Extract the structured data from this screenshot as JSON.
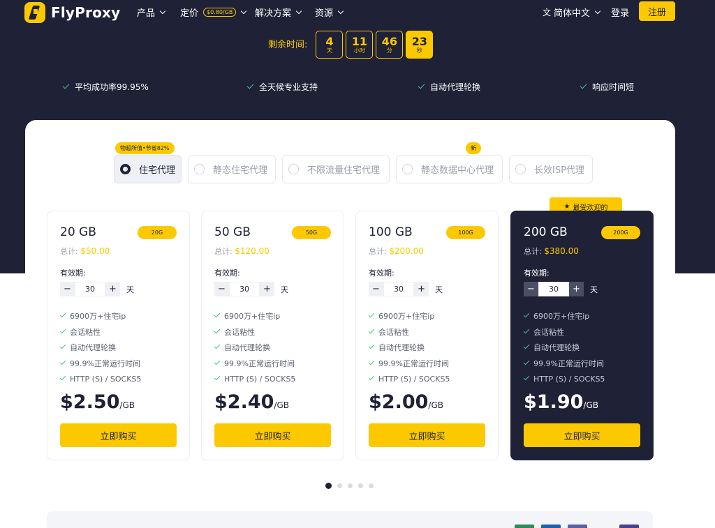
{
  "nav": {
    "brand": "FlyProxy",
    "items": [
      {
        "label": "产品"
      },
      {
        "label": "定价",
        "pill": "$0.80/GB"
      },
      {
        "label": "解决方案"
      },
      {
        "label": "资源"
      }
    ],
    "language": "简体中文",
    "login": "登录",
    "register": "注册"
  },
  "countdown": {
    "label": "剩余时间:",
    "units": [
      {
        "value": "4",
        "unit": "天"
      },
      {
        "value": "11",
        "unit": "小时"
      },
      {
        "value": "46",
        "unit": "分"
      },
      {
        "value": "23",
        "unit": "秒"
      }
    ]
  },
  "features": [
    "平均成功率99.95%",
    "全天候专业支持",
    "自动代理轮换",
    "响应时间短"
  ],
  "product_tabs": [
    {
      "label": "住宅代理",
      "selected": true,
      "tag": "物超所值•节省82%"
    },
    {
      "label": "静态住宅代理",
      "selected": false
    },
    {
      "label": "不限流量住宅代理",
      "selected": false
    },
    {
      "label": "静态数据中心代理",
      "selected": false,
      "tag": "新"
    },
    {
      "label": "长效ISP代理",
      "selected": false
    }
  ],
  "popular_label": "最受欢迎的",
  "plans": [
    {
      "title": "20 GB",
      "badge": "20G",
      "total_label": "总计:",
      "total": "$50.00",
      "valid_label": "有效期:",
      "days": "30",
      "unit": "天",
      "features": [
        "6900万+住宅ip",
        "会话粘性",
        "自动代理轮换",
        "99.9%正常运行时间",
        "HTTP (S) / SOCKS5"
      ],
      "price": "$2.50",
      "per": "/GB",
      "buy": "立即购买"
    },
    {
      "title": "50 GB",
      "badge": "50G",
      "total_label": "总计:",
      "total": "$120.00",
      "valid_label": "有效期:",
      "days": "30",
      "unit": "天",
      "features": [
        "6900万+住宅ip",
        "会话粘性",
        "自动代理轮换",
        "99.9%正常运行时间",
        "HTTP (S) / SOCKS5"
      ],
      "price": "$2.40",
      "per": "/GB",
      "buy": "立即购买"
    },
    {
      "title": "100 GB",
      "badge": "100G",
      "total_label": "总计:",
      "total": "$200.00",
      "valid_label": "有效期:",
      "days": "30",
      "unit": "天",
      "features": [
        "6900万+住宅ip",
        "会话粘性",
        "自动代理轮换",
        "99.9%正常运行时间",
        "HTTP (S) / SOCKS5"
      ],
      "price": "$2.00",
      "per": "/GB",
      "buy": "立即购买"
    },
    {
      "title": "200 GB",
      "badge": "200G",
      "total_label": "总计:",
      "total": "$380.00",
      "valid_label": "有效期:",
      "days": "30",
      "unit": "天",
      "features": [
        "6900万+住宅ip",
        "会话粘性",
        "自动代理轮换",
        "99.9%正常运行时间",
        "HTTP (S) / SOCKS5"
      ],
      "price": "$1.90",
      "per": "/GB",
      "buy": "立即购买"
    }
  ],
  "pagination": {
    "count": 5,
    "active": 1
  },
  "colors": {
    "navy": "#1f2237",
    "accent": "#fcc900",
    "check": "#3ec48e"
  }
}
